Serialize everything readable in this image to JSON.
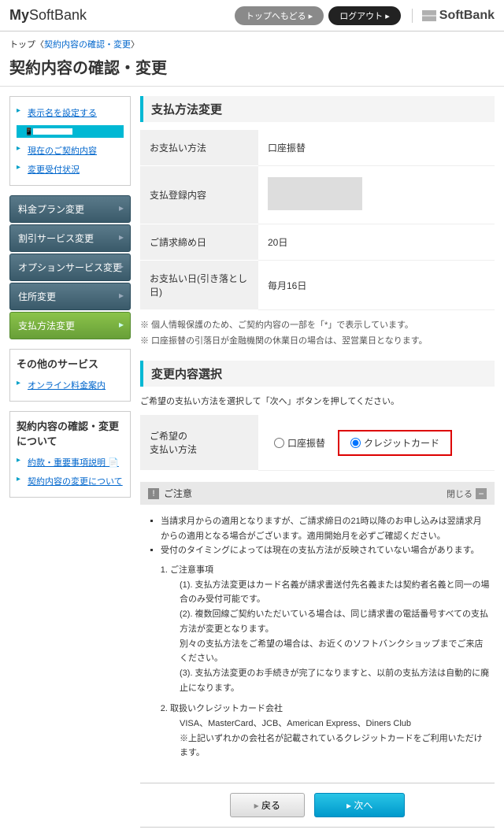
{
  "header": {
    "logo_my": "My",
    "logo_softbank": "SoftBank",
    "btn_top": "トップへもどる ▸",
    "btn_logout": "ログアウト ▸",
    "brand": "SoftBank"
  },
  "breadcrumb": {
    "top": "トップ",
    "current": "契約内容の確認・変更"
  },
  "page_title": "契約内容の確認・変更",
  "sidebar": {
    "set_display_name": "表示名を設定する",
    "links1": [
      "現在のご契約内容",
      "変更受付状況"
    ],
    "nav": [
      "料金プラン変更",
      "割引サービス変更",
      "オプションサービス変更",
      "住所変更",
      "支払方法変更"
    ],
    "other_title": "その他のサービス",
    "other_link": "オンライン料金案内",
    "about_title": "契約内容の確認・変更について",
    "about_links": [
      "約款・重要事項説明",
      "契約内容の変更について"
    ]
  },
  "section1": {
    "title": "支払方法変更",
    "rows": {
      "method_label": "お支払い方法",
      "method_value": "口座振替",
      "reg_label": "支払登録内容",
      "close_label": "ご請求締め日",
      "close_value": "20日",
      "debit_label": "お支払い日(引き落とし日)",
      "debit_value": "毎月16日"
    },
    "note1": "※ 個人情報保護のため、ご契約内容の一部を「*」で表示しています。",
    "note2": "※ 口座振替の引落日が金融機関の休業日の場合は、翌営業日となります。"
  },
  "section2": {
    "title": "変更内容選択",
    "instruct": "ご希望の支払い方法を選択して「次へ」ボタンを押してください。",
    "choice_label": "ご希望の\n支払い方法",
    "opt1": "口座振替",
    "opt2": "クレジットカード"
  },
  "notice": {
    "bar_title": "ご注意",
    "close": "閉じる",
    "bullets": [
      "当請求月からの適用となりますが、ご請求締日の21時以降のお申し込みは翌請求月からの適用となる場合がございます。適用開始月を必ずご確認ください。",
      "受付のタイミングによっては現在の支払方法が反映されていない場合があります。"
    ],
    "ol1_title": "ご注意事項",
    "ol1_items": [
      "(1). 支払方法変更はカード名義が請求書送付先名義または契約者名義と同一の場合のみ受付可能です。",
      "(2). 複数回線ご契約いただいている場合は、同じ請求書の電話番号すべての支払方法が変更となります。",
      "別々の支払方法をご希望の場合は、お近くのソフトバンクショップまでご来店ください。",
      "(3). 支払方法変更のお手続きが完了になりますと、以前の支払方法は自動的に廃止になります。"
    ],
    "ol2_title": "取扱いクレジットカード会社",
    "ol2_line1": "VISA、MasterCard、JCB、American Express、Diners Club",
    "ol2_line2": "※上記いずれかの会社名が記載されているクレジットカードをご利用いただけます。"
  },
  "footer": {
    "back": "戻る",
    "next": "次へ"
  }
}
